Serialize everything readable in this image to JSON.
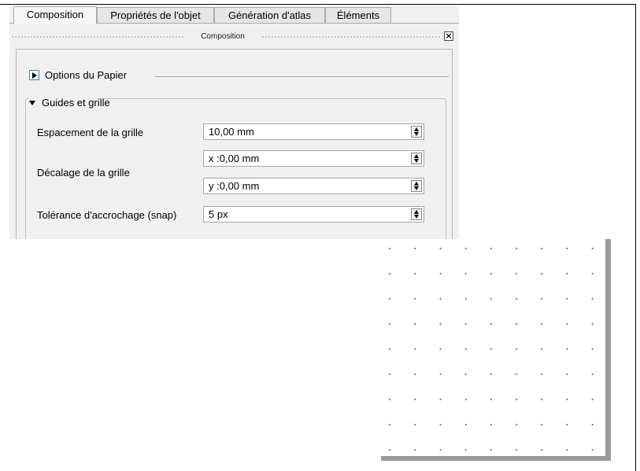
{
  "tabs": [
    {
      "label": "Composition",
      "active": true
    },
    {
      "label": "Propriétés de l'objet",
      "active": false
    },
    {
      "label": "Génération d'atlas",
      "active": false
    },
    {
      "label": "Éléments",
      "active": false
    }
  ],
  "dock": {
    "title": "Composition",
    "close_icon": "close-icon"
  },
  "sections": {
    "paper": {
      "label": "Options du Papier",
      "expanded": false
    },
    "grid": {
      "label": "Guides et grille",
      "expanded": true
    }
  },
  "fields": {
    "spacing": {
      "label": "Espacement de la grille",
      "value": "10,00 mm"
    },
    "offset": {
      "label": "Décalage de la grille",
      "x_value": "x :0,00 mm",
      "y_value": "y :0,00 mm"
    },
    "snap": {
      "label": "Tolérance d'accrochage (snap)",
      "value": "5 px"
    }
  },
  "colors": {
    "accent": "#3c7fc0",
    "panel_bg": "#f0f0f0",
    "page": "#ffffff",
    "shadow": "#9a9a9a"
  }
}
